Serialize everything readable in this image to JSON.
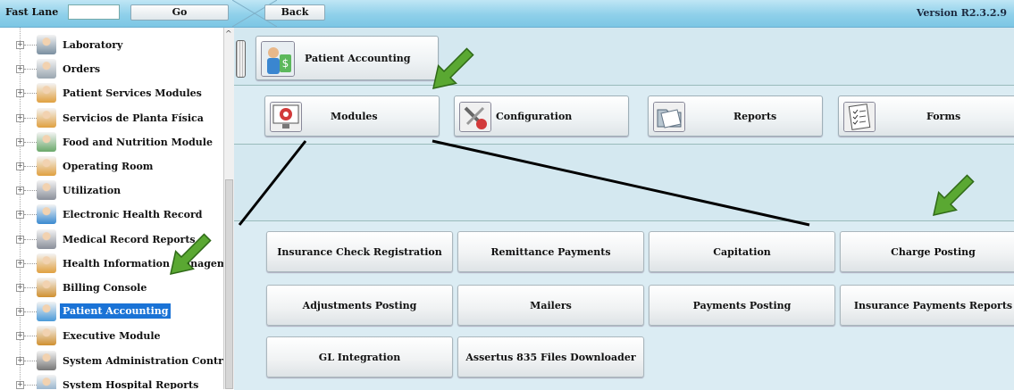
{
  "topbar": {
    "fast_lane_label": "Fast Lane",
    "go_label": "Go",
    "back_label": "Back",
    "version": "Version R2.3.2.9"
  },
  "tree": {
    "items": [
      {
        "label": "Laboratory",
        "icon": "microscope-icon",
        "color": "#7a8fa0"
      },
      {
        "label": "Orders",
        "icon": "document-icon",
        "color": "#9aa6b0"
      },
      {
        "label": "Patient Services Modules",
        "icon": "person-icon",
        "color": "#e0a040"
      },
      {
        "label": "Servicios de Planta Física",
        "icon": "person-icon",
        "color": "#e0a040"
      },
      {
        "label": "Food and Nutrition Module",
        "icon": "food-icon",
        "color": "#6aa86a"
      },
      {
        "label": "Operating Room",
        "icon": "person-icon",
        "color": "#e0a040"
      },
      {
        "label": "Utilization",
        "icon": "stethoscope-icon",
        "color": "#8a8f9a"
      },
      {
        "label": "Electronic Health Record",
        "icon": "ehr-icon",
        "color": "#3a8ad0"
      },
      {
        "label": "Medical Record Reports",
        "icon": "stethoscope-icon",
        "color": "#8a8f9a"
      },
      {
        "label": "Health Information Management",
        "icon": "person-icon",
        "color": "#e0a040"
      },
      {
        "label": "Billing Console",
        "icon": "person-icon",
        "color": "#d09030"
      },
      {
        "label": "Patient Accounting",
        "icon": "person-money-icon",
        "color": "#4a9ad8"
      },
      {
        "label": "Executive Module",
        "icon": "person-icon",
        "color": "#d09030"
      },
      {
        "label": "System Administration Control",
        "icon": "tools-icon",
        "color": "#777"
      },
      {
        "label": "System Hospital Reports",
        "icon": "report-icon",
        "color": "#7aa0c0"
      }
    ],
    "selected_index": 11
  },
  "header": {
    "title": "Patient Accounting"
  },
  "modules": {
    "items": [
      {
        "label": "Modules",
        "icon": "monitor-icon"
      },
      {
        "label": "Configuration",
        "icon": "tools-icon"
      },
      {
        "label": "Reports",
        "icon": "folder-icon"
      },
      {
        "label": "Forms",
        "icon": "checklist-icon"
      }
    ]
  },
  "submodules": {
    "items": [
      "Insurance Check Registration",
      "Remittance Payments",
      "Capitation",
      "Charge Posting",
      "Adjustments Posting",
      "Mailers",
      "Payments Posting",
      "Insurance Payments Reports",
      "GL Integration",
      "Assertus 835 Files Downloader"
    ]
  },
  "colors": {
    "accent": "#1a73d6",
    "arrow": "#5aa832",
    "topbar": "#8fd0ea"
  }
}
